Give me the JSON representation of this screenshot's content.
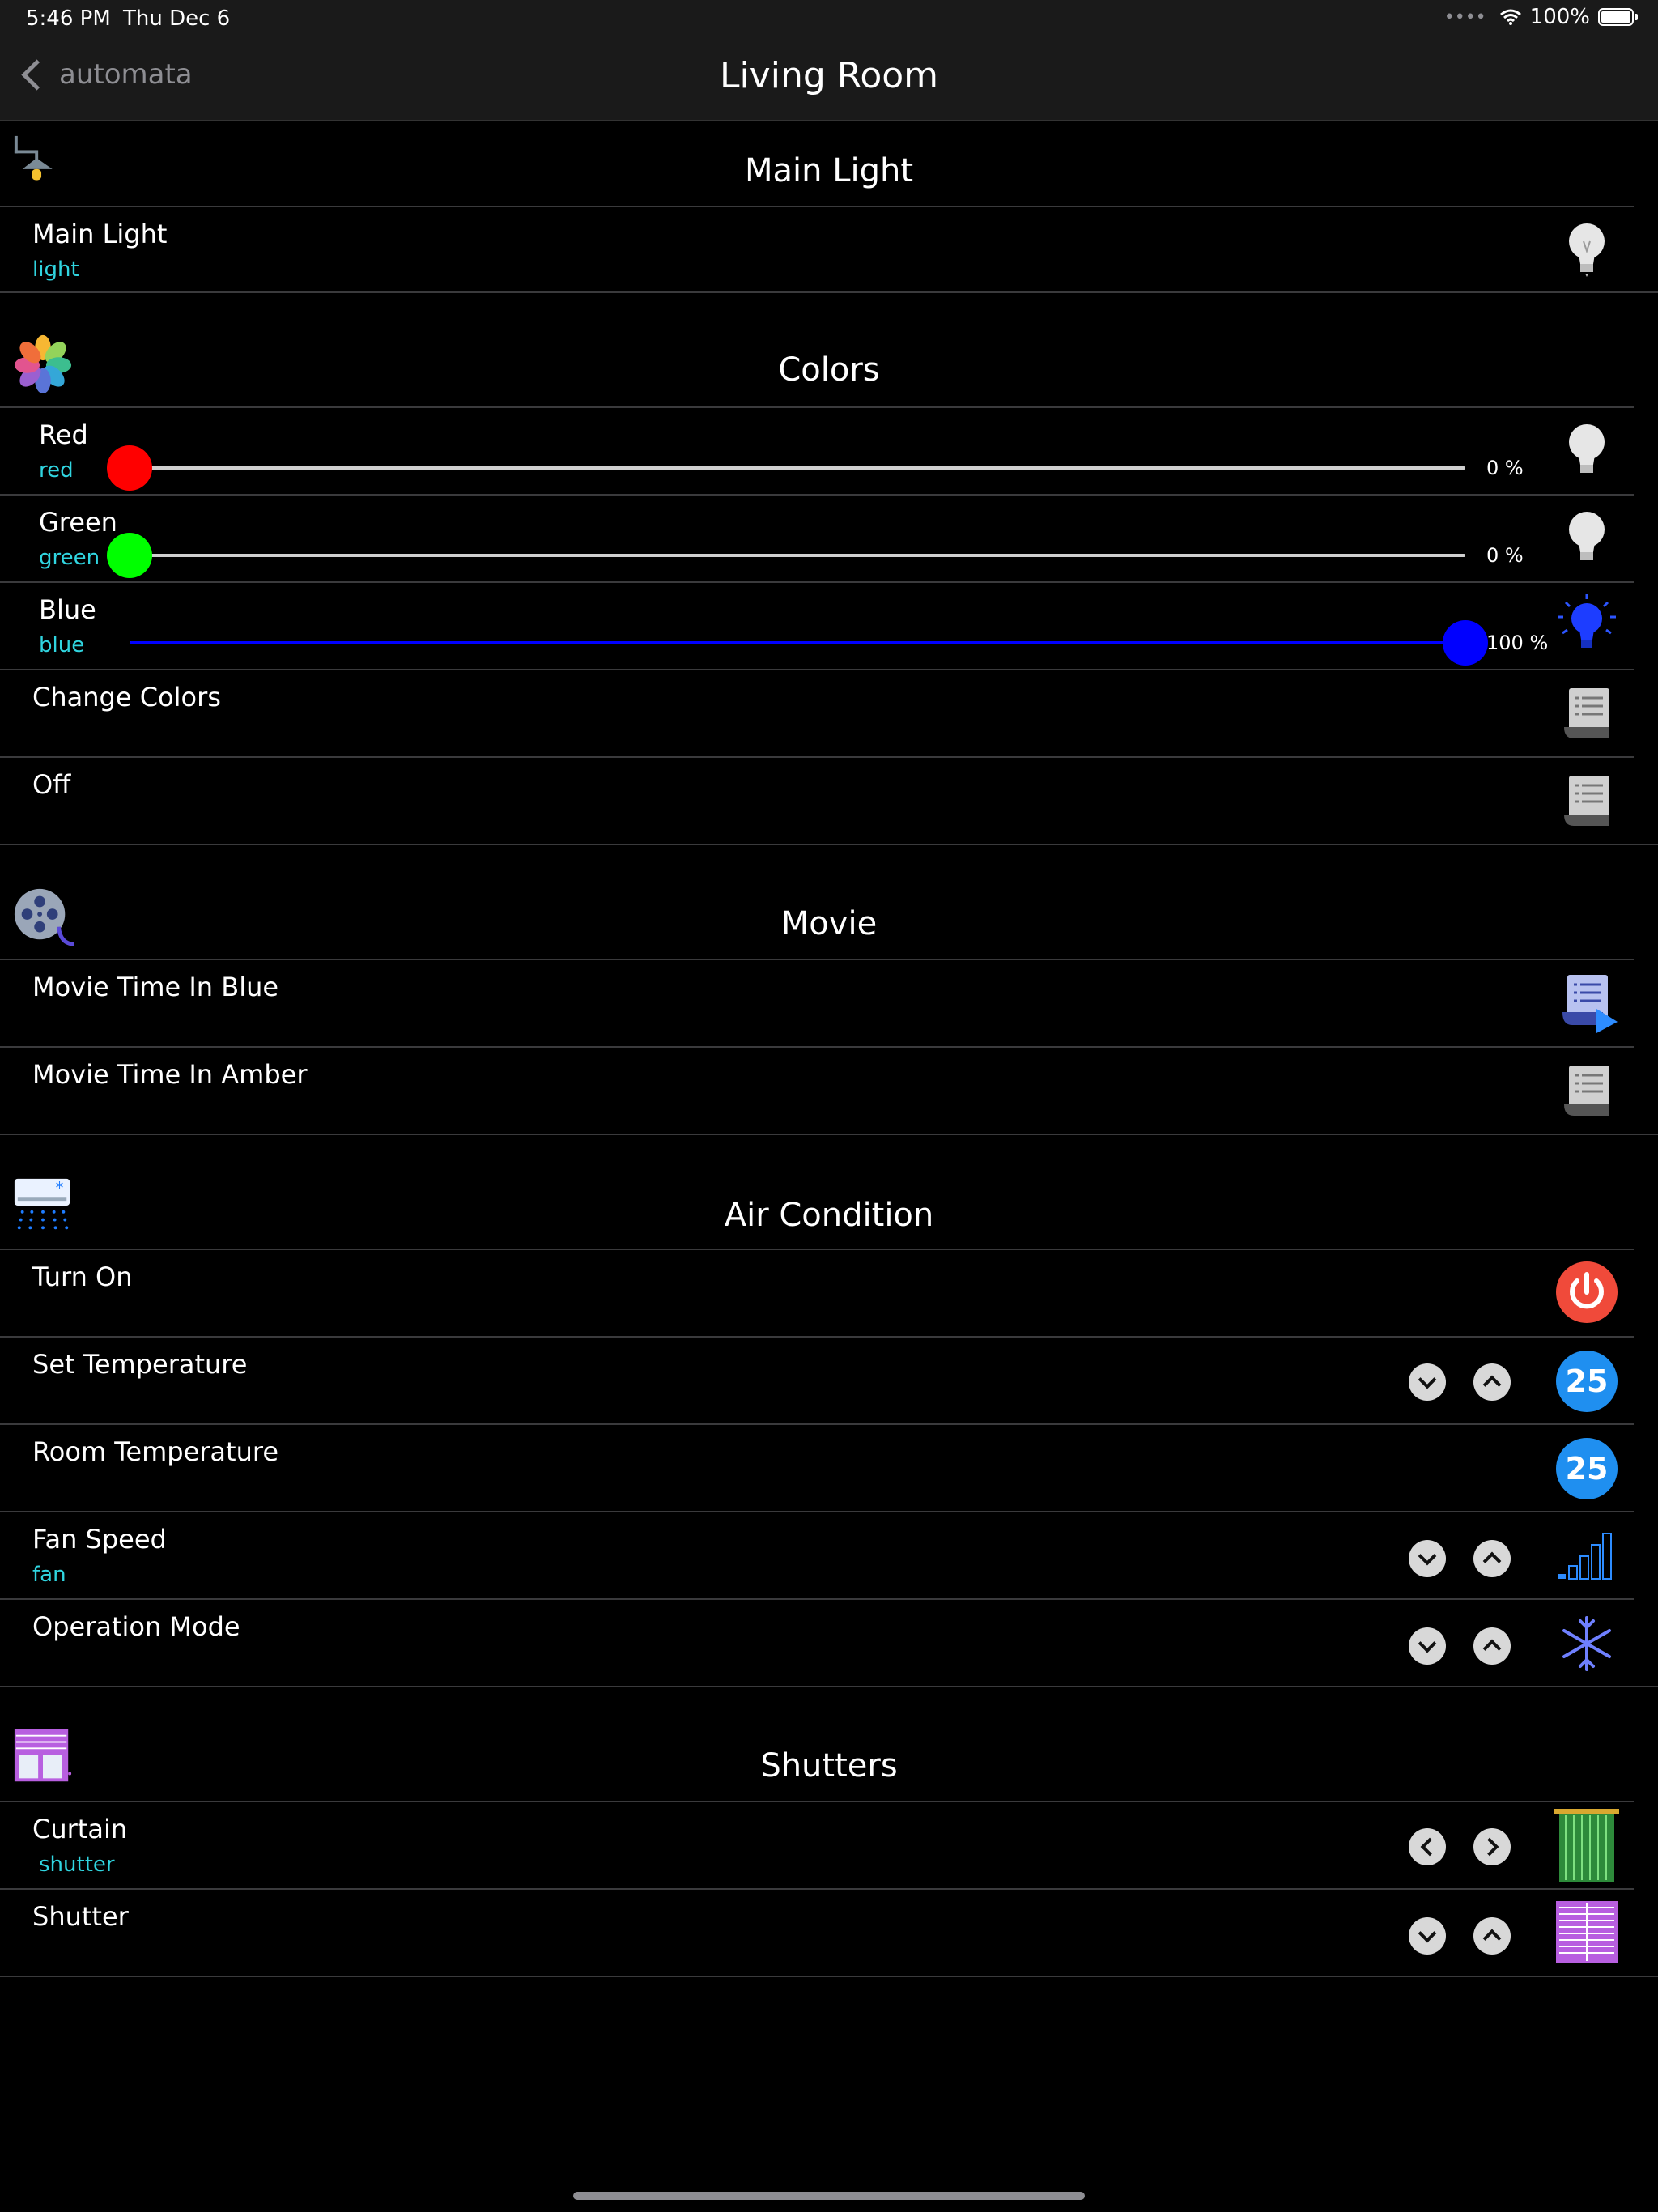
{
  "status": {
    "time": "5:46 PM",
    "date": "Thu Dec 6",
    "battery": "100%"
  },
  "nav": {
    "back_label": "automata",
    "title": "Living Room"
  },
  "sections": {
    "main_light": {
      "title": "Main Light",
      "rows": [
        {
          "label": "Main Light",
          "sub": "light"
        }
      ]
    },
    "colors": {
      "title": "Colors",
      "rows": [
        {
          "label": "Red",
          "sub": "red",
          "value": 0,
          "pct": "0 %",
          "color": "#ff0000"
        },
        {
          "label": "Green",
          "sub": "green",
          "value": 0,
          "pct": "0 %",
          "color": "#00ff00"
        },
        {
          "label": "Blue",
          "sub": "blue",
          "value": 100,
          "pct": "100 %",
          "color": "#0000ff"
        },
        {
          "label": "Change Colors"
        },
        {
          "label": "Off"
        }
      ]
    },
    "movie": {
      "title": "Movie",
      "rows": [
        {
          "label": "Movie Time In Blue"
        },
        {
          "label": "Movie Time In Amber"
        }
      ]
    },
    "air": {
      "title": "Air Condition",
      "rows": [
        {
          "label": "Turn On"
        },
        {
          "label": "Set Temperature",
          "value": "25"
        },
        {
          "label": "Room Temperature",
          "value": "25"
        },
        {
          "label": "Fan Speed",
          "sub": "fan"
        },
        {
          "label": "Operation Mode"
        }
      ]
    },
    "shutters": {
      "title": "Shutters",
      "rows": [
        {
          "label": "Curtain",
          "sub": "shutter"
        },
        {
          "label": "Shutter"
        }
      ]
    }
  },
  "icons": {
    "section_main_light": "lamp-icon",
    "section_colors": "color-wheel-icon",
    "section_movie": "film-reel-icon",
    "section_air": "air-conditioner-icon",
    "section_shutters": "shutter-icon"
  },
  "colors": {
    "accent_sub": "#30d5e0",
    "temp_badge": "#1f8ff0",
    "power": "#f04a3a"
  }
}
